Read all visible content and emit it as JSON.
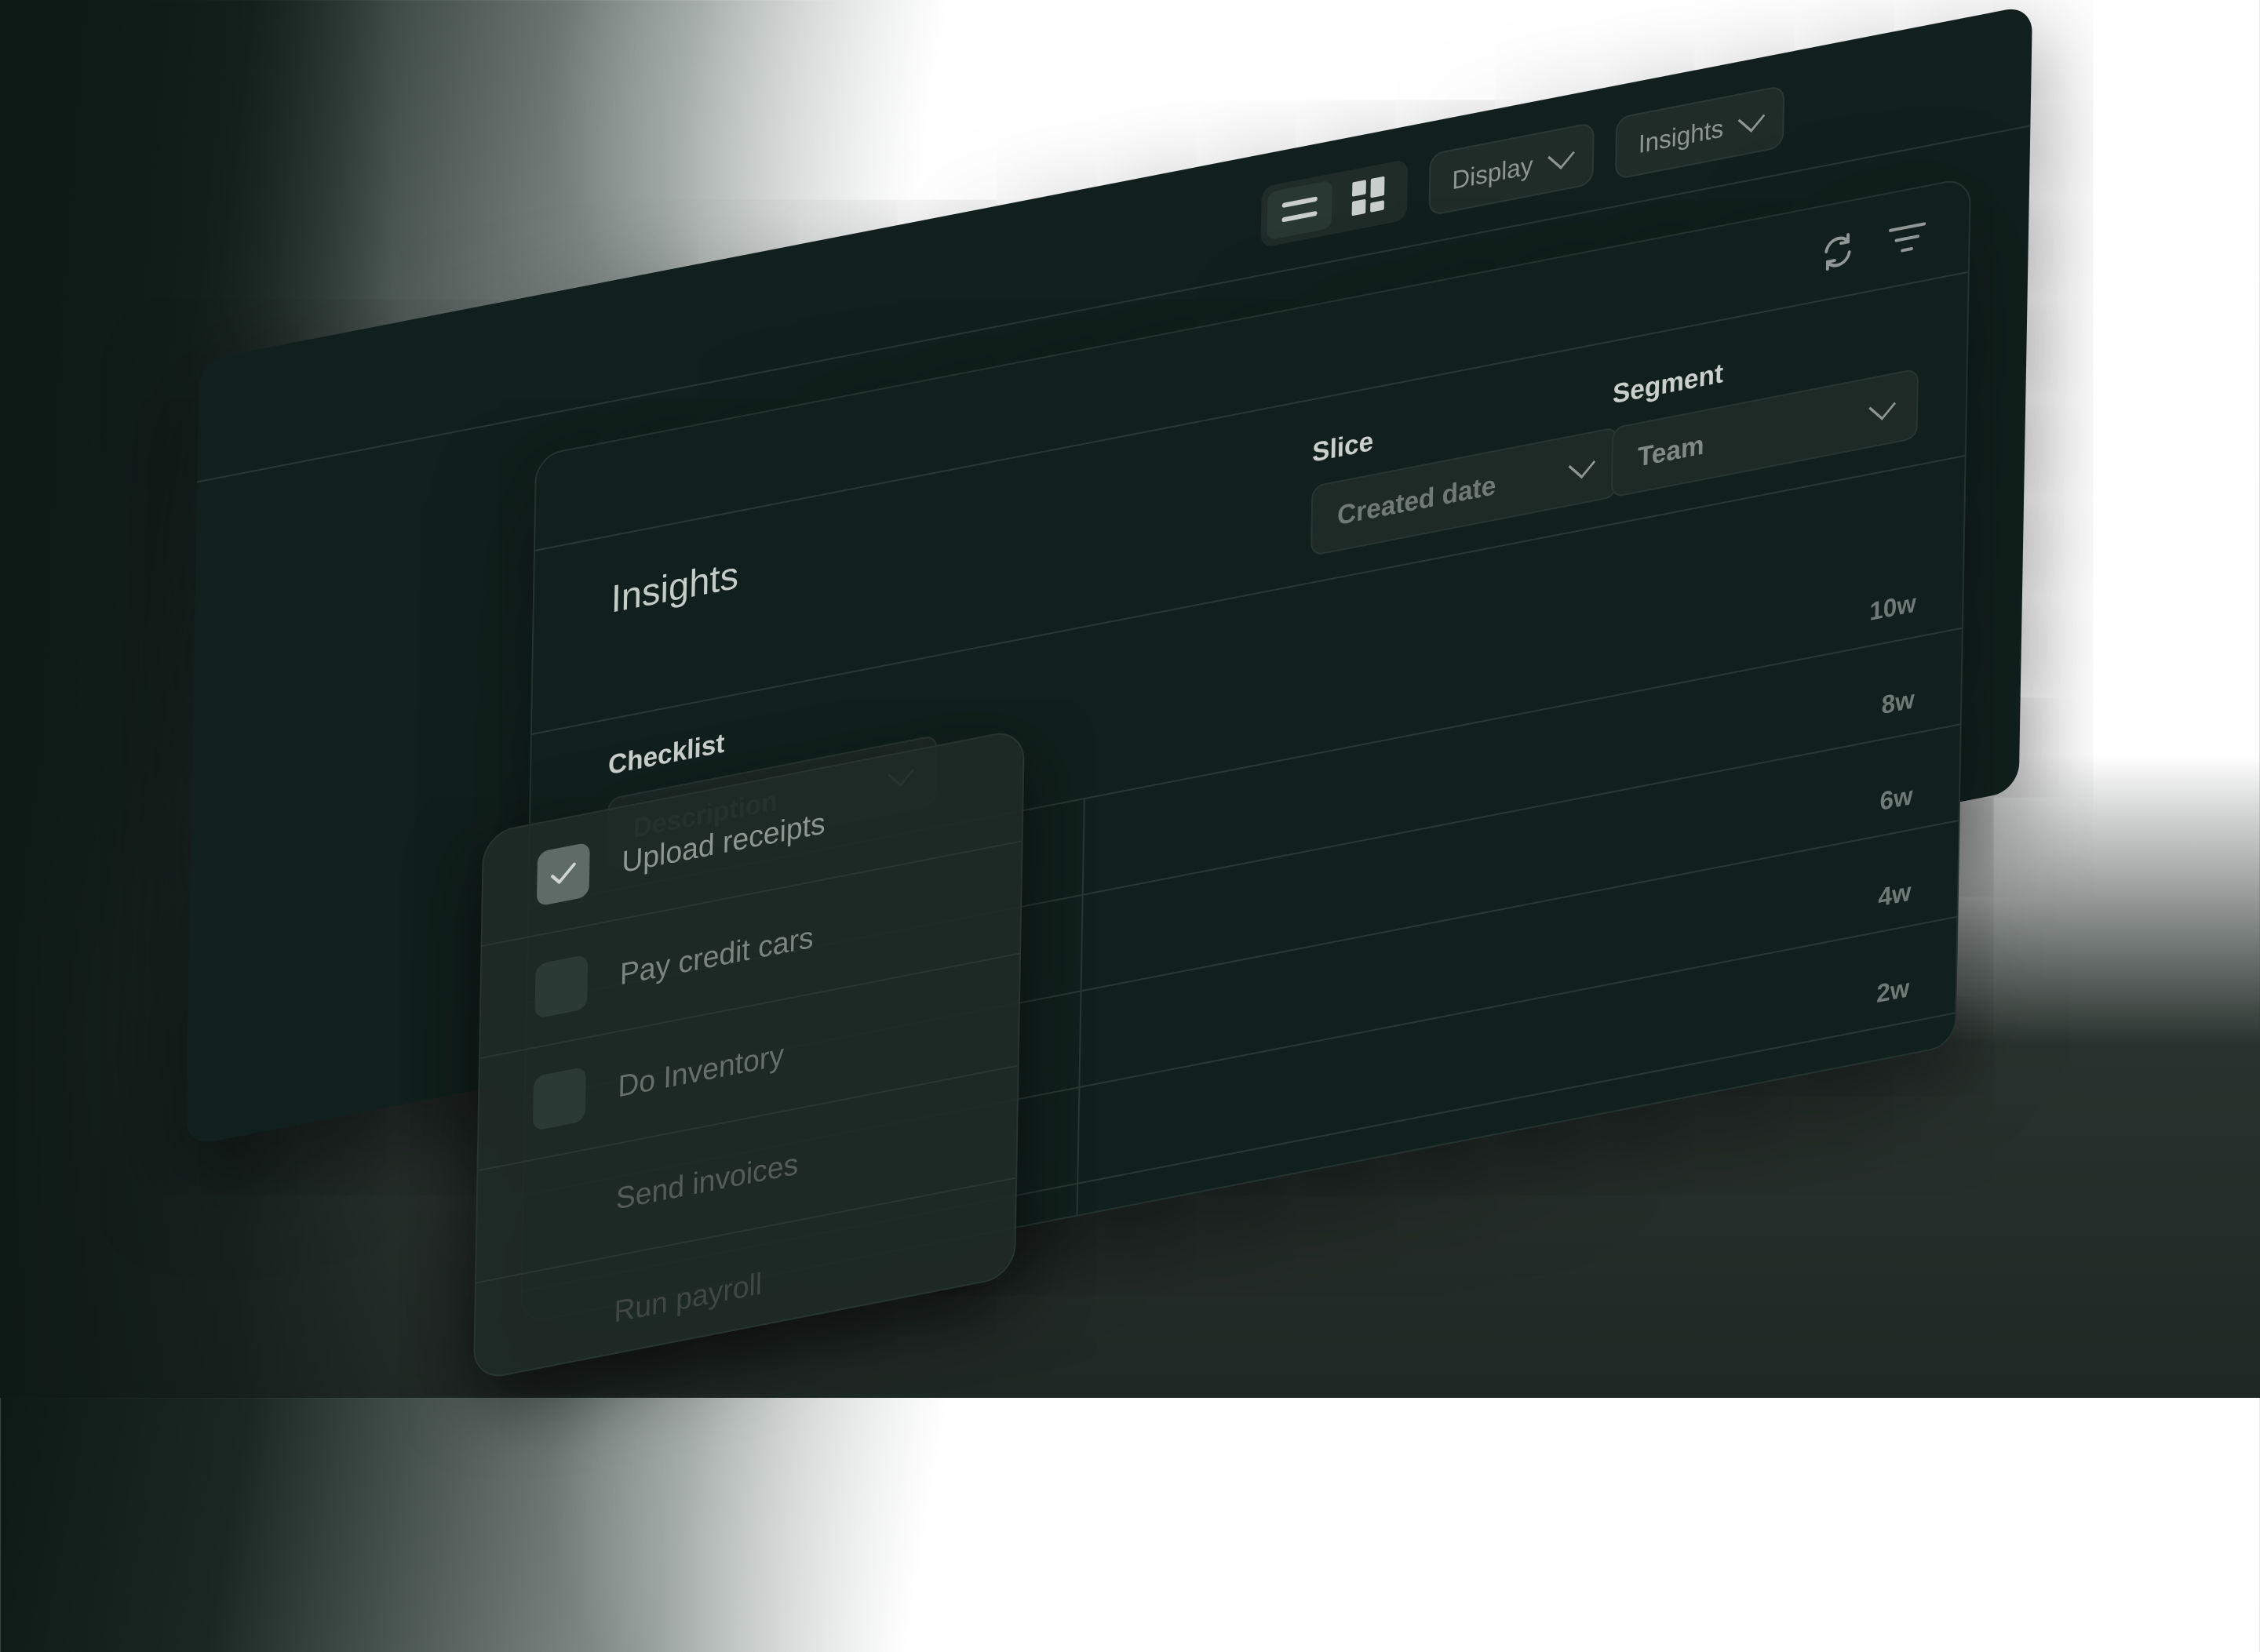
{
  "toolbar": {
    "display_label": "Display",
    "insights_label": "Insights"
  },
  "panel": {
    "title": "Insights",
    "checklist_label": "Checklist",
    "checklist_select": "Description",
    "slice_label": "Slice",
    "slice_select": "Created date",
    "segment_label": "Segment",
    "segment_select": "Team"
  },
  "y_ticks": [
    "10w",
    "8w",
    "6w",
    "4w",
    "2w"
  ],
  "checklist": {
    "items": [
      {
        "label": "Upload receipts",
        "checked": true
      },
      {
        "label": "Pay credit cars",
        "checked": false
      },
      {
        "label": "Do Inventory",
        "checked": false
      },
      {
        "label": "Send invoices",
        "checked": false
      },
      {
        "label": "Run payroll",
        "checked": false
      }
    ]
  },
  "icons": {
    "list_view": "list-icon",
    "grid_view": "grid-icon",
    "refresh": "refresh-icon",
    "filter": "filter-icon",
    "check": "check-icon"
  }
}
